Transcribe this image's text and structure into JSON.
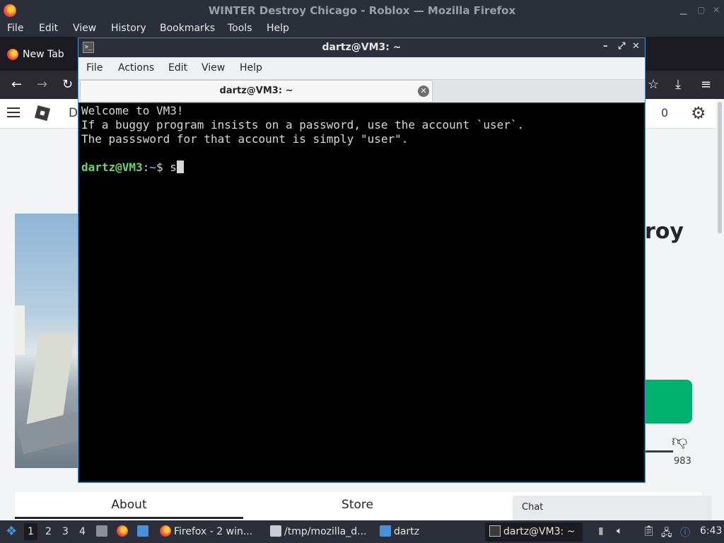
{
  "firefox": {
    "window_title": "WINTER Destroy Chicago - Roblox — Mozilla Firefox",
    "menu": [
      "File",
      "Edit",
      "View",
      "History",
      "Bookmarks",
      "Tools",
      "Help"
    ],
    "tab_label": "New Tab"
  },
  "roblox": {
    "header_letter": "D",
    "robux_count": "0",
    "game_title_fragment": "roy",
    "dislike_count": "983",
    "tabs": [
      "About",
      "Store"
    ],
    "chat_label": "Chat"
  },
  "terminal": {
    "window_title": "dartz@VM3: ~",
    "menu": [
      "File",
      "Actions",
      "Edit",
      "View",
      "Help"
    ],
    "tab_label": "dartz@VM3: ~",
    "lines": [
      "Welcome to VM3!",
      "If a buggy program insists on a password, use the account `user`.",
      "The passsword for that account is simply \"user\"."
    ],
    "prompt_user": "dartz@VM3",
    "prompt_sep": ":",
    "prompt_path": "~",
    "prompt_symbol": "$ ",
    "typed_input": "s"
  },
  "taskbar": {
    "workspaces": [
      "1",
      "2",
      "3",
      "4"
    ],
    "active_workspace": "1",
    "tasks": {
      "firefox": "Firefox - 2 win...",
      "tmp": "/tmp/mozilla_d...",
      "dartz": "dartz",
      "terminal": "dartz@VM3: ~"
    },
    "clock": "6:43"
  },
  "colors": {
    "prompt_user": "#6ad66a",
    "prompt_path": "#5b9bf0",
    "play_button": "#00b06f",
    "terminal_bg": "#000000"
  },
  "icons": [
    "firefox-icon",
    "back-icon",
    "forward-icon",
    "reload-icon",
    "bookmark-star-icon",
    "download-icon",
    "hamburger-menu-icon",
    "roblox-logo-icon",
    "settings-gear-icon",
    "thumbs-down-icon",
    "terminal-icon",
    "close-tab-icon",
    "volume-icon",
    "network-icon",
    "clipboard-icon"
  ]
}
